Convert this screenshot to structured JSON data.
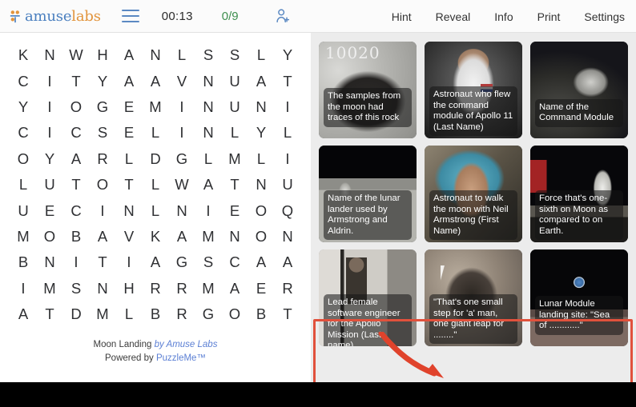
{
  "header": {
    "logo": {
      "part1": "amuse",
      "part2": "labs",
      "icon": "amuselabs-logo-icon"
    },
    "menu_icon": "hamburger-menu-icon",
    "timer": "00:13",
    "score": "0/9",
    "invite_icon": "add-person-icon",
    "menu_items": [
      {
        "label": "Hint"
      },
      {
        "label": "Reveal"
      },
      {
        "label": "Info"
      },
      {
        "label": "Print"
      },
      {
        "label": "Settings"
      }
    ],
    "accent_blue": "#5b89c2",
    "accent_orange": "#e2943c",
    "score_green": "#3e8f4e"
  },
  "grid": {
    "rows": 11,
    "cols": 11,
    "letters": [
      [
        "K",
        "N",
        "W",
        "H",
        "A",
        "N",
        "L",
        "S",
        "S",
        "L",
        "Y"
      ],
      [
        "C",
        "I",
        "T",
        "Y",
        "A",
        "A",
        "V",
        "N",
        "U",
        "A",
        "T"
      ],
      [
        "Y",
        "I",
        "O",
        "G",
        "E",
        "M",
        "I",
        "N",
        "U",
        "N",
        "I"
      ],
      [
        "C",
        "I",
        "C",
        "S",
        "E",
        "L",
        "I",
        "N",
        "L",
        "Y",
        "L"
      ],
      [
        "O",
        "Y",
        "A",
        "R",
        "L",
        "D",
        "G",
        "L",
        "M",
        "L",
        "I"
      ],
      [
        "L",
        "U",
        "T",
        "O",
        "T",
        "L",
        "W",
        "A",
        "T",
        "N",
        "U"
      ],
      [
        "U",
        "E",
        "C",
        "I",
        "N",
        "L",
        "N",
        "I",
        "E",
        "O",
        "Q"
      ],
      [
        "M",
        "O",
        "B",
        "A",
        "V",
        "K",
        "A",
        "M",
        "N",
        "O",
        "N"
      ],
      [
        "B",
        "N",
        "I",
        "T",
        "I",
        "A",
        "G",
        "S",
        "C",
        "A",
        "A"
      ],
      [
        "I",
        "M",
        "S",
        "N",
        "H",
        "R",
        "R",
        "M",
        "A",
        "E",
        "R"
      ],
      [
        "A",
        "T",
        "D",
        "M",
        "L",
        "B",
        "R",
        "G",
        "O",
        "B",
        "T"
      ]
    ]
  },
  "credits": {
    "line1_prefix": "Moon Landing ",
    "line1_by": "by ",
    "line1_brand": "Amuse Labs",
    "line2_prefix": "Powered by ",
    "line2_brand": "PuzzleMe™"
  },
  "clues": [
    {
      "text": "The samples from the moon had traces of this rock",
      "photo": "ph-rock",
      "photo_name": "moon-rock-sample-photo",
      "label_pos": "low"
    },
    {
      "text": "Astronaut who flew the command module of Apollo 11 (Last Name)",
      "photo": "ph-astro-collins",
      "photo_name": "astronaut-portrait-photo",
      "label_pos": "mid"
    },
    {
      "text": "Name of the Command Module",
      "photo": "ph-moonsurf-dark",
      "photo_name": "command-module-over-moon-photo",
      "label_pos": "low"
    },
    {
      "text": "Name of the lunar lander used by Armstrong and Aldrin.",
      "photo": "ph-lander",
      "photo_name": "lunar-lander-photo",
      "label_pos": "mid"
    },
    {
      "text": "Astronaut to walk the moon with Neil Armstrong (First Name)",
      "photo": "ph-aldrin-window",
      "photo_name": "astronaut-in-lander-photo",
      "label_pos": "mid"
    },
    {
      "text": "Force that's one-sixth on Moon as compared to on Earth.",
      "photo": "ph-flag",
      "photo_name": "astronaut-with-flag-photo",
      "label_pos": "mid"
    },
    {
      "text": "Lead female software engineer for the Apollo Mission (Last name)",
      "photo": "ph-hamilton",
      "photo_name": "engineer-with-code-stack-photo",
      "label_pos": "mid"
    },
    {
      "text": "\"That's one small step for 'a' man, one giant leap for ........\"",
      "photo": "ph-bootprint",
      "photo_name": "bootprint-on-moon-photo",
      "label_pos": "mid"
    },
    {
      "text": "Lunar Module landing site: \"Sea of ............\"",
      "photo": "ph-earthrise",
      "photo_name": "earthrise-photo",
      "label_pos": "low"
    }
  ],
  "annotation": {
    "highlight_color": "#e1513c",
    "arrow_color": "#e0432c",
    "target": "clue-card-7"
  }
}
